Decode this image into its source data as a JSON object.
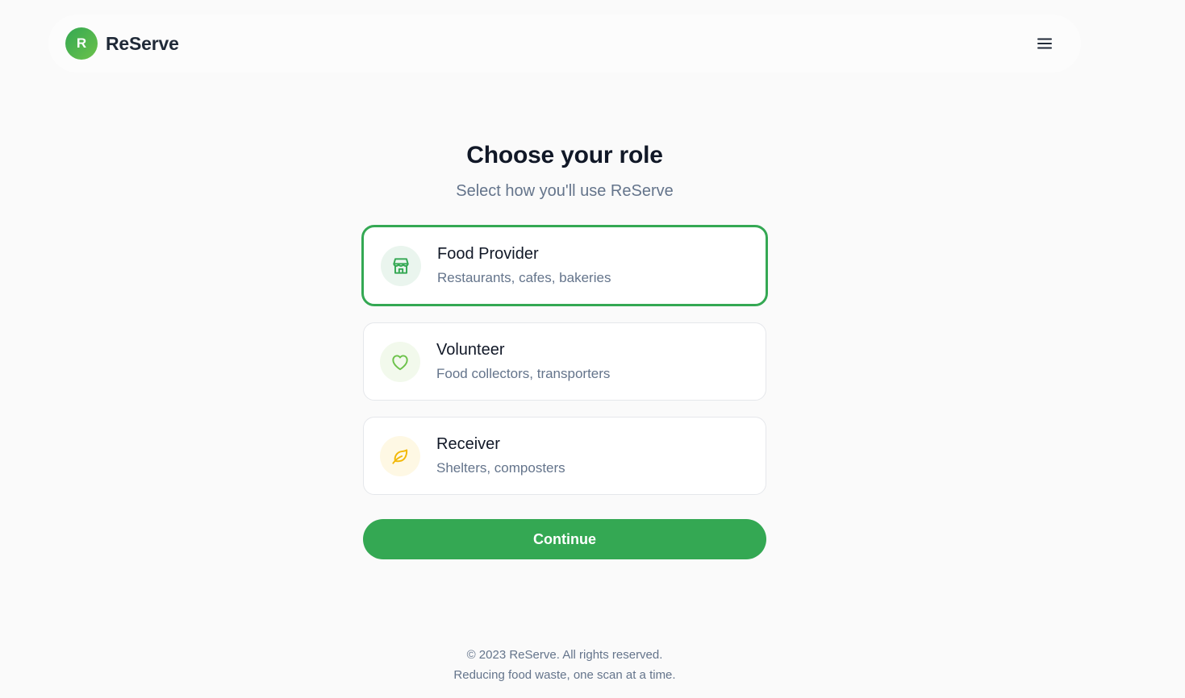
{
  "header": {
    "logo_letter": "R",
    "brand_name": "ReServe",
    "menu_icon": "hamburger-menu-icon"
  },
  "main": {
    "title": "Choose your role",
    "subtitle": "Select how you'll use ReServe"
  },
  "roles": [
    {
      "title": "Food Provider",
      "description": "Restaurants, cafes, bakeries",
      "icon": "store-icon",
      "selected": true,
      "accent": "#34a853",
      "icon_bg": "#eaf5ee"
    },
    {
      "title": "Volunteer",
      "description": "Food collectors, transporters",
      "icon": "heart-icon",
      "selected": false,
      "accent": "#6cc24a",
      "icon_bg": "#f2f9ec"
    },
    {
      "title": "Receiver",
      "description": "Shelters, composters",
      "icon": "leaf-icon",
      "selected": false,
      "accent": "#f2b807",
      "icon_bg": "#fef8e4"
    }
  ],
  "actions": {
    "continue_label": "Continue"
  },
  "footer": {
    "copyright": "© 2023 ReServe. All rights reserved.",
    "tagline": "Reducing food waste, one scan at a time."
  },
  "colors": {
    "brand": "#34a853",
    "text_primary": "#111827",
    "text_secondary": "#64748b"
  }
}
